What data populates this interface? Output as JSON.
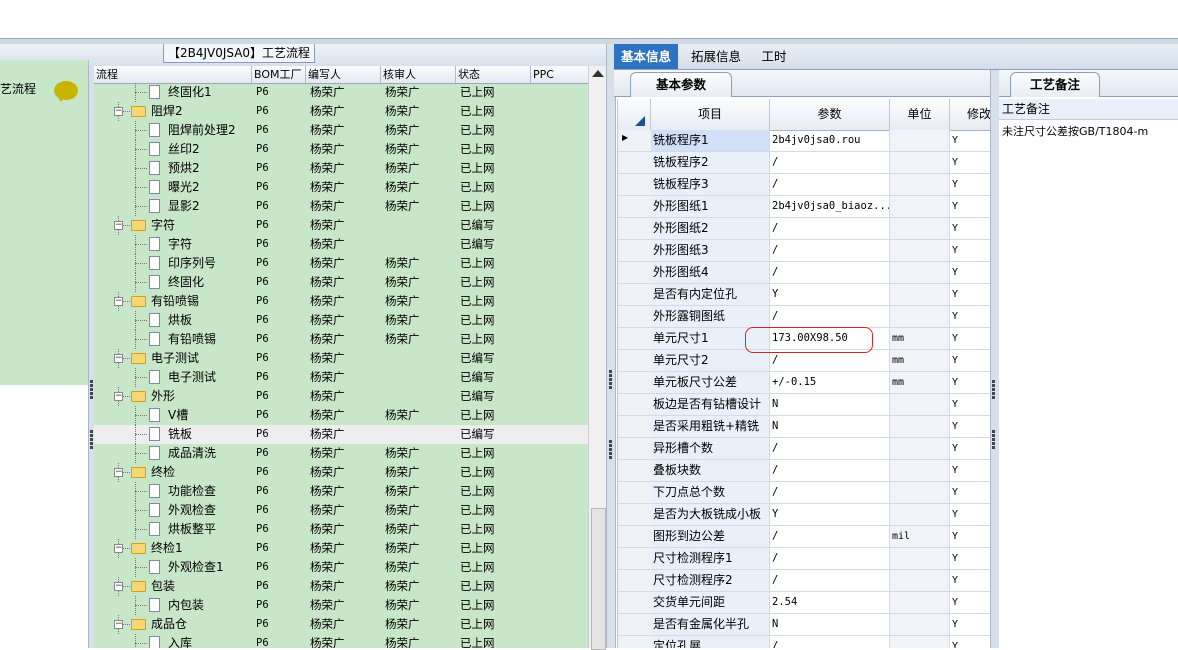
{
  "left_panel": {
    "title": "艺流程"
  },
  "flow_tab": {
    "label": "【2B4JV0JSA0】工艺流程"
  },
  "grid": {
    "headers": [
      "流程",
      "BOM工厂",
      "编写人",
      "核审人",
      "状态",
      "PPC"
    ],
    "rows": [
      {
        "name": "终固化1",
        "level": 2,
        "type": "file",
        "bom": "P6",
        "writer": "杨荣广",
        "auditor": "杨荣广",
        "status": "已上网"
      },
      {
        "name": "阻焊2",
        "level": 1,
        "type": "folder",
        "bom": "P6",
        "writer": "杨荣广",
        "auditor": "杨荣广",
        "status": "已上网"
      },
      {
        "name": "阻焊前处理2",
        "level": 2,
        "type": "file",
        "bom": "P6",
        "writer": "杨荣广",
        "auditor": "杨荣广",
        "status": "已上网"
      },
      {
        "name": "丝印2",
        "level": 2,
        "type": "file",
        "bom": "P6",
        "writer": "杨荣广",
        "auditor": "杨荣广",
        "status": "已上网"
      },
      {
        "name": "预烘2",
        "level": 2,
        "type": "file",
        "bom": "P6",
        "writer": "杨荣广",
        "auditor": "杨荣广",
        "status": "已上网"
      },
      {
        "name": "曝光2",
        "level": 2,
        "type": "file",
        "bom": "P6",
        "writer": "杨荣广",
        "auditor": "杨荣广",
        "status": "已上网"
      },
      {
        "name": "显影2",
        "level": 2,
        "type": "file",
        "bom": "P6",
        "writer": "杨荣广",
        "auditor": "杨荣广",
        "status": "已上网"
      },
      {
        "name": "字符",
        "level": 1,
        "type": "folder",
        "bom": "P6",
        "writer": "杨荣广",
        "auditor": "",
        "status": "已编写"
      },
      {
        "name": "字符",
        "level": 2,
        "type": "file",
        "bom": "P6",
        "writer": "杨荣广",
        "auditor": "",
        "status": "已编写"
      },
      {
        "name": "印序列号",
        "level": 2,
        "type": "file",
        "bom": "P6",
        "writer": "杨荣广",
        "auditor": "杨荣广",
        "status": "已上网"
      },
      {
        "name": "终固化",
        "level": 2,
        "type": "file",
        "bom": "P6",
        "writer": "杨荣广",
        "auditor": "杨荣广",
        "status": "已上网"
      },
      {
        "name": "有铅喷锡",
        "level": 1,
        "type": "folder",
        "bom": "P6",
        "writer": "杨荣广",
        "auditor": "杨荣广",
        "status": "已上网"
      },
      {
        "name": "烘板",
        "level": 2,
        "type": "file",
        "bom": "P6",
        "writer": "杨荣广",
        "auditor": "杨荣广",
        "status": "已上网"
      },
      {
        "name": "有铅喷锡",
        "level": 2,
        "type": "file",
        "bom": "P6",
        "writer": "杨荣广",
        "auditor": "杨荣广",
        "status": "已上网"
      },
      {
        "name": "电子测试",
        "level": 1,
        "type": "folder",
        "bom": "P6",
        "writer": "杨荣广",
        "auditor": "",
        "status": "已编写"
      },
      {
        "name": "电子测试",
        "level": 2,
        "type": "file",
        "bom": "P6",
        "writer": "杨荣广",
        "auditor": "",
        "status": "已编写"
      },
      {
        "name": "外形",
        "level": 1,
        "type": "folder",
        "bom": "P6",
        "writer": "杨荣广",
        "auditor": "",
        "status": "已编写"
      },
      {
        "name": "V槽",
        "level": 2,
        "type": "file",
        "bom": "P6",
        "writer": "杨荣广",
        "auditor": "杨荣广",
        "status": "已上网"
      },
      {
        "name": "铣板",
        "level": 2,
        "type": "file",
        "bom": "P6",
        "writer": "杨荣广",
        "auditor": "",
        "status": "已编写",
        "selected": true
      },
      {
        "name": "成品清洗",
        "level": 2,
        "type": "file",
        "bom": "P6",
        "writer": "杨荣广",
        "auditor": "杨荣广",
        "status": "已上网"
      },
      {
        "name": "终检",
        "level": 1,
        "type": "folder",
        "bom": "P6",
        "writer": "杨荣广",
        "auditor": "杨荣广",
        "status": "已上网"
      },
      {
        "name": "功能检查",
        "level": 2,
        "type": "file",
        "bom": "P6",
        "writer": "杨荣广",
        "auditor": "杨荣广",
        "status": "已上网"
      },
      {
        "name": "外观检查",
        "level": 2,
        "type": "file",
        "bom": "P6",
        "writer": "杨荣广",
        "auditor": "杨荣广",
        "status": "已上网"
      },
      {
        "name": "烘板整平",
        "level": 2,
        "type": "file",
        "bom": "P6",
        "writer": "杨荣广",
        "auditor": "杨荣广",
        "status": "已上网"
      },
      {
        "name": "终检1",
        "level": 1,
        "type": "folder",
        "bom": "P6",
        "writer": "杨荣广",
        "auditor": "杨荣广",
        "status": "已上网"
      },
      {
        "name": "外观检查1",
        "level": 2,
        "type": "file",
        "bom": "P6",
        "writer": "杨荣广",
        "auditor": "杨荣广",
        "status": "已上网"
      },
      {
        "name": "包装",
        "level": 1,
        "type": "folder",
        "bom": "P6",
        "writer": "杨荣广",
        "auditor": "杨荣广",
        "status": "已上网"
      },
      {
        "name": "内包装",
        "level": 2,
        "type": "file",
        "bom": "P6",
        "writer": "杨荣广",
        "auditor": "杨荣广",
        "status": "已上网"
      },
      {
        "name": "成品仓",
        "level": 1,
        "type": "folder",
        "bom": "P6",
        "writer": "杨荣广",
        "auditor": "杨荣广",
        "status": "已上网"
      },
      {
        "name": "入库",
        "level": 2,
        "type": "file",
        "bom": "P6",
        "writer": "杨荣广",
        "auditor": "杨荣广",
        "status": "已上网"
      }
    ]
  },
  "tabs": [
    "基本信息",
    "拓展信息",
    "工时"
  ],
  "sub_tab": "基本参数",
  "params": {
    "headers": [
      "项目",
      "参数",
      "单位",
      "修改"
    ],
    "rows": [
      {
        "name": "铣板程序1",
        "value": "2b4jv0jsa0.rou",
        "unit": "",
        "mod": "Y",
        "selected": true
      },
      {
        "name": "铣板程序2",
        "value": "/",
        "unit": "",
        "mod": "Y"
      },
      {
        "name": "铣板程序3",
        "value": "/",
        "unit": "",
        "mod": "Y"
      },
      {
        "name": "外形图纸1",
        "value": "2b4jv0jsa0_biaoz...",
        "unit": "",
        "mod": "Y"
      },
      {
        "name": "外形图纸2",
        "value": "/",
        "unit": "",
        "mod": "Y"
      },
      {
        "name": "外形图纸3",
        "value": "/",
        "unit": "",
        "mod": "Y"
      },
      {
        "name": "外形图纸4",
        "value": "/",
        "unit": "",
        "mod": "Y"
      },
      {
        "name": "是否有内定位孔",
        "value": "Y",
        "unit": "",
        "mod": "Y"
      },
      {
        "name": "外形露铜图纸",
        "value": "/",
        "unit": "",
        "mod": "Y"
      },
      {
        "name": "单元尺寸1",
        "value": "173.00X98.50",
        "unit": "mm",
        "mod": "Y"
      },
      {
        "name": "单元尺寸2",
        "value": "/",
        "unit": "mm",
        "mod": "Y"
      },
      {
        "name": "单元板尺寸公差",
        "value": "+/-0.15",
        "unit": "mm",
        "mod": "Y"
      },
      {
        "name": "板边是否有钻槽设计",
        "value": "N",
        "unit": "",
        "mod": "Y"
      },
      {
        "name": "是否采用粗铣+精铣",
        "value": "N",
        "unit": "",
        "mod": "Y"
      },
      {
        "name": "异形槽个数",
        "value": "/",
        "unit": "",
        "mod": "Y"
      },
      {
        "name": "叠板块数",
        "value": "/",
        "unit": "",
        "mod": "Y"
      },
      {
        "name": "下刀点总个数",
        "value": "/",
        "unit": "",
        "mod": "Y"
      },
      {
        "name": "是否为大板铣成小板",
        "value": "Y",
        "unit": "",
        "mod": "Y"
      },
      {
        "name": "图形到边公差",
        "value": "/",
        "unit": "mil",
        "mod": "Y"
      },
      {
        "name": "尺寸检测程序1",
        "value": "/",
        "unit": "",
        "mod": "Y"
      },
      {
        "name": "尺寸检测程序2",
        "value": "/",
        "unit": "",
        "mod": "Y"
      },
      {
        "name": "交货单元间距",
        "value": "2.54",
        "unit": "",
        "mod": "Y"
      },
      {
        "name": "是否有金属化半孔",
        "value": "N",
        "unit": "",
        "mod": "Y"
      },
      {
        "name": "定位孔展",
        "value": "/",
        "unit": "",
        "mod": "Y"
      }
    ]
  },
  "notes": {
    "tab": "工艺备注",
    "header": "工艺备注",
    "text": "未注尺寸公差按GB/T1804-m"
  },
  "colors": {
    "grid_bg": "#c8e6c8",
    "tab_active": "#2e72c2",
    "highlight": "#dd2222"
  }
}
